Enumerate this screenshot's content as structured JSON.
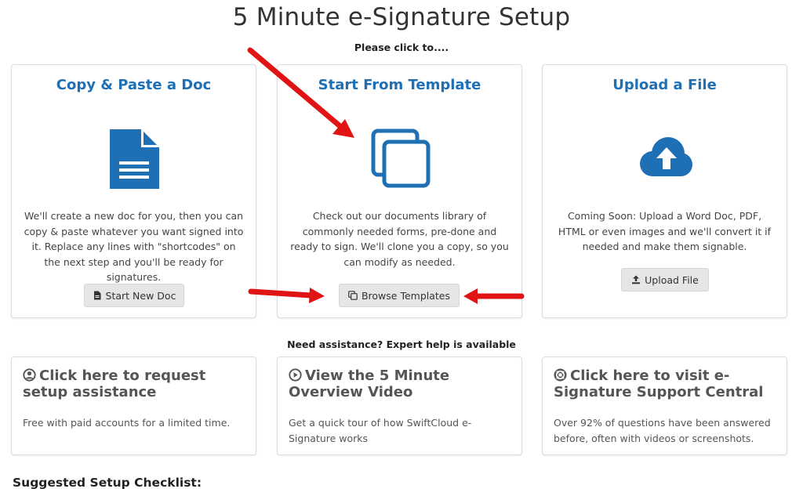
{
  "page": {
    "title": "5 Minute e-Signature Setup",
    "click_prompt": "Please click to....",
    "assist_prompt": "Need assistance? Expert help is available",
    "checklist_title": "Suggested Setup Checklist:"
  },
  "options": [
    {
      "title": "Copy & Paste a Doc",
      "icon": "document-icon",
      "description": "We'll create a new doc for you, then you can copy & paste whatever you want signed into it. Replace any lines with \"shortcodes\" on the next step and you'll be ready for signatures.",
      "button_label": "Start New Doc",
      "button_icon": "file-icon"
    },
    {
      "title": "Start From Template",
      "icon": "copy-icon",
      "description": "Check out our documents library of commonly needed forms, pre-done and ready to sign. We'll clone you a copy, so you can modify as needed.",
      "button_label": "Browse Templates",
      "button_icon": "clone-icon"
    },
    {
      "title": "Upload a File",
      "icon": "cloud-upload-icon",
      "description": "Coming Soon: Upload a Word Doc, PDF, HTML or even images and we'll convert it if needed and make them signable.",
      "button_label": "Upload File",
      "button_icon": "upload-icon"
    }
  ],
  "help": [
    {
      "title": "Click here to request setup assistance",
      "icon": "user-circle-icon",
      "description": "Free with paid accounts for a limited time."
    },
    {
      "title": "View the 5 Minute Overview Video",
      "icon": "play-circle-icon",
      "description": "Get a quick tour of how SwiftCloud e-Signature works"
    },
    {
      "title": "Click here to visit e-Signature Support Central",
      "icon": "life-ring-icon",
      "description": "Over 92% of questions have been answered before, often with videos or screenshots."
    }
  ],
  "colors": {
    "accent": "#1f6fb5",
    "arrow": "#e01414",
    "button_bg": "#e6e6e6"
  }
}
